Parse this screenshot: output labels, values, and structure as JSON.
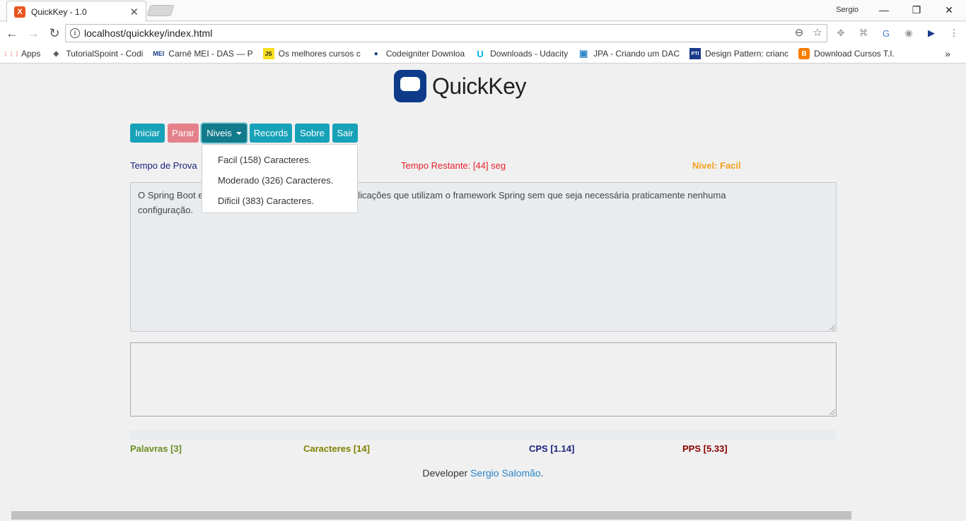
{
  "browser": {
    "tab_title": "QuickKey - 1.0",
    "tab_favicon": "X",
    "user": "Sergio",
    "url": "localhost/quickkey/index.html",
    "bookmarks": [
      {
        "label": "Apps",
        "icon": "apps-grid-icon",
        "icon_text": "⋮⋮⋮",
        "color": "#e44"
      },
      {
        "label": "TutorialSpoint - Codi",
        "icon": "tutorialspoint-icon",
        "icon_text": "◈",
        "color": "#555"
      },
      {
        "label": "Carnê MEI - DAS — P",
        "icon": "mei-icon",
        "icon_text": "MEI",
        "color": "#1a3b8a"
      },
      {
        "label": "Os melhores cursos c",
        "icon": "js-icon",
        "icon_text": "JS",
        "color": "#c9a400"
      },
      {
        "label": "Codeigniter Downloa",
        "icon": "codeigniter-icon",
        "icon_text": "●",
        "color": "#1a3b8a"
      },
      {
        "label": "Downloads - Udacity",
        "icon": "udacity-icon",
        "icon_text": "U",
        "color": "#02b3e4"
      },
      {
        "label": "JPA - Criando um DAC",
        "icon": "doc-icon",
        "icon_text": "▣",
        "color": "#2a85c9"
      },
      {
        "label": "Design Pattern: crianc",
        "icon": "pti-icon",
        "icon_text": "PTI",
        "color": "#1a3b8a"
      },
      {
        "label": "Download Cursos T.I.",
        "icon": "blogger-icon",
        "icon_text": "B",
        "color": "#f57d00"
      }
    ]
  },
  "app": {
    "logo_text": "QuickKey",
    "buttons": {
      "start": "Iniciar",
      "stop": "Parar",
      "levels": "Niveis",
      "records": "Records",
      "about": "Sobre",
      "exit": "Sair"
    },
    "levels_menu": [
      "Facil (158) Caracteres.",
      "Moderado (326) Caracteres.",
      "Dificil (383) Caracteres."
    ],
    "status": {
      "test_time": "Tempo de Prova",
      "remaining": "Tempo Restante: [44] seg",
      "level": "Nivel: Facil"
    },
    "reference_text_a": "O Spring Boot e",
    "reference_text_b": "nento de aplicações que utilizam o framework Spring sem que seja necessária praticamente nenhuma",
    "reference_text_c": "configuração.",
    "typed_text": "",
    "progress": 0,
    "metrics": {
      "words": "Palavras [3]",
      "chars": "Caracteres [14]",
      "cps": "CPS [1.14]",
      "pps": "PPS [5.33]"
    },
    "footer_prefix": "Developer ",
    "footer_link": "Sergio Salomão",
    "footer_suffix": "."
  },
  "colors": {
    "teal": "#17a2b8",
    "stop_red": "#e4808a",
    "remaining_red": "#e8212d",
    "level_orange": "#f4a21e",
    "navy": "#1a237e",
    "olive_green": "#6b8e23",
    "olive": "#808000",
    "maroon": "#8b0000"
  }
}
